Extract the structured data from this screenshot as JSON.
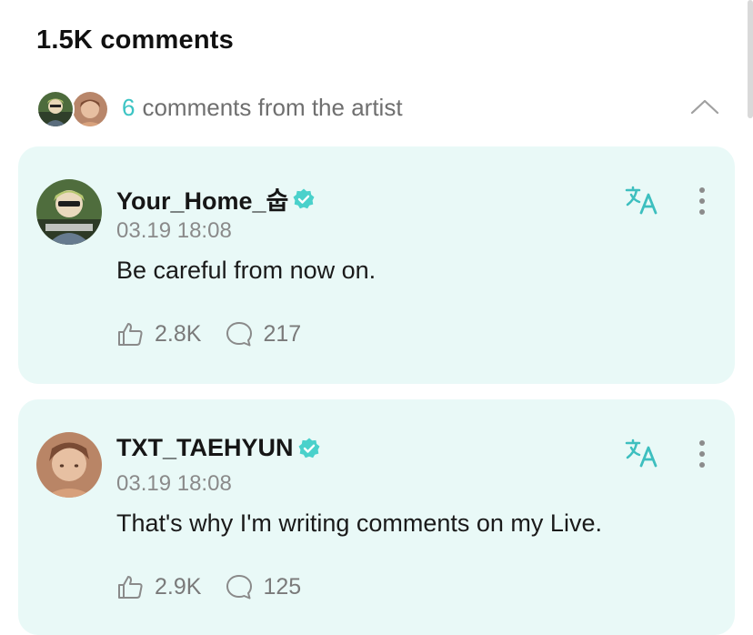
{
  "header": {
    "comment_count": "1.5K comments"
  },
  "artist_summary": {
    "count": "6",
    "text": "comments from the artist",
    "avatars": [
      "artist-avatar-1",
      "artist-avatar-2"
    ],
    "toggle_icon": "chevron-up-icon"
  },
  "colors": {
    "accent": "#3cc4c4",
    "card_background": "#e9f9f7",
    "muted_text": "#8a8a8a"
  },
  "comments": [
    {
      "username": "Your_Home_숩",
      "verified": true,
      "timestamp": "03.19 18:08",
      "text": "Be careful from now on.",
      "likes": "2.8K",
      "replies": "217",
      "icons": [
        "translate-icon",
        "more-options-icon",
        "like-icon",
        "reply-icon"
      ]
    },
    {
      "username": "TXT_TAEHYUN",
      "verified": true,
      "timestamp": "03.19 18:08",
      "text": "That's why I'm writing comments on my Live.",
      "likes": "2.9K",
      "replies": "125",
      "icons": [
        "translate-icon",
        "more-options-icon",
        "like-icon",
        "reply-icon"
      ]
    }
  ]
}
